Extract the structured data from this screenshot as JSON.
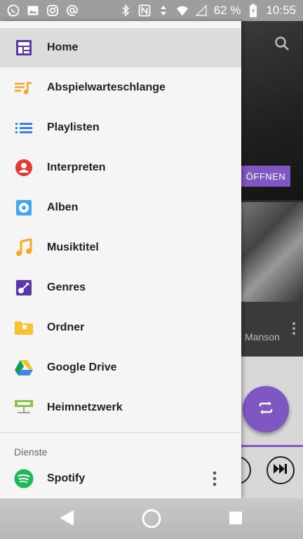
{
  "statusbar": {
    "battery_percent": "62 %",
    "time": "10:55",
    "left_icons": [
      "whatsapp-icon",
      "image-icon",
      "instagram-icon",
      "at-icon"
    ],
    "right_icons": [
      "bluetooth-icon",
      "nfc-icon",
      "data-arrows-icon",
      "wifi-icon",
      "signal-icon",
      "battery-icon"
    ]
  },
  "background_app": {
    "open_button": "ÖFFNEN",
    "artist_text": "Manson"
  },
  "drawer": {
    "items": [
      {
        "label": "Home",
        "icon": "home-icon",
        "color": "#5e35b1",
        "active": true
      },
      {
        "label": "Abspielwarteschlange",
        "icon": "queue-icon",
        "color": "#f4a62a",
        "active": false
      },
      {
        "label": "Playlisten",
        "icon": "playlist-icon",
        "color": "#3f7de0",
        "active": false
      },
      {
        "label": "Interpreten",
        "icon": "artist-icon",
        "color": "#e53935",
        "active": false
      },
      {
        "label": "Alben",
        "icon": "album-icon",
        "color": "#42a5f5",
        "active": false
      },
      {
        "label": "Musiktitel",
        "icon": "music-note-icon",
        "color": "#f9a825",
        "active": false
      },
      {
        "label": "Genres",
        "icon": "guitar-icon",
        "color": "#5e35b1",
        "active": false
      },
      {
        "label": "Ordner",
        "icon": "folder-icon",
        "color": "#fbc02d",
        "active": false
      },
      {
        "label": "Google Drive",
        "icon": "google-drive-icon",
        "color": "#1e88e5",
        "active": false
      },
      {
        "label": "Heimnetzwerk",
        "icon": "home-network-icon",
        "color": "#8bc34a",
        "active": false
      }
    ],
    "section_title": "Dienste",
    "services": [
      {
        "label": "Spotify",
        "icon": "spotify-icon",
        "color": "#1db954"
      }
    ]
  },
  "navbar": {
    "buttons": [
      "back-icon",
      "home-circle-icon",
      "recents-icon"
    ]
  }
}
